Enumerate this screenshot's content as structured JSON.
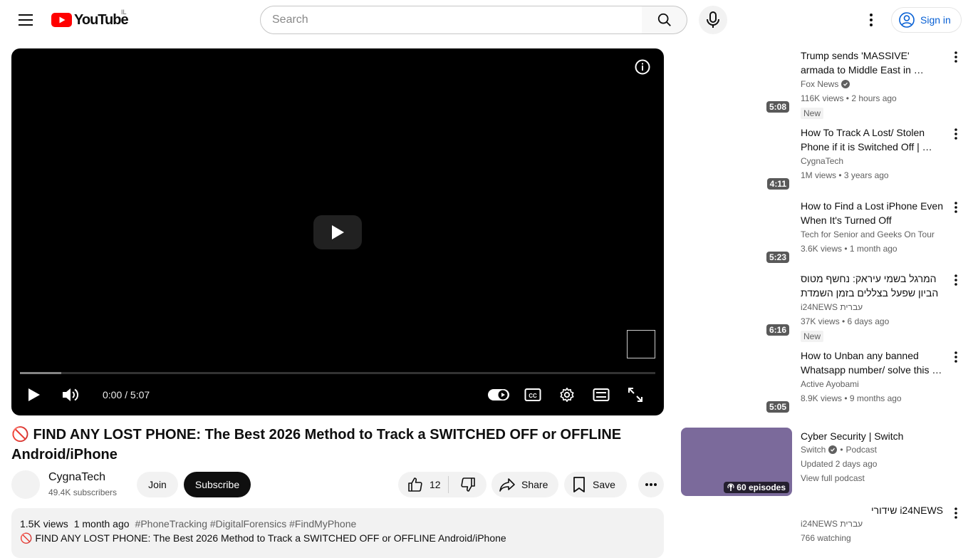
{
  "header": {
    "logo_text": "YouTube",
    "region": "IL",
    "search_placeholder": "Search",
    "signin_label": "Sign in"
  },
  "player": {
    "time_current": "0:00",
    "time_total": "5:07",
    "time_display": "0:00 / 5:07",
    "buffered_fraction": 0.065
  },
  "video": {
    "title": "🚫 FIND ANY LOST PHONE: The Best 2026 Method to Track a SWITCHED OFF or OFFLINE Android/iPhone",
    "channel_name": "CygnaTech",
    "subscribers": "49.4K subscribers",
    "join_label": "Join",
    "subscribe_label": "Subscribe",
    "like_count": "12",
    "share_label": "Share",
    "save_label": "Save",
    "views": "1.5K views",
    "age": "1 month ago",
    "tags": "#PhoneTracking #DigitalForensics #FindMyPhone",
    "description_first_line": "🚫 FIND ANY LOST PHONE: The Best 2026 Method to Track a SWITCHED OFF or OFFLINE Android/iPhone"
  },
  "recommendations": [
    {
      "title": "Trump sends 'MASSIVE' armada to Middle East in …",
      "channel": "Fox News",
      "verified": true,
      "meta": "116K views • 2 hours ago",
      "badge": "New",
      "duration": "5:08"
    },
    {
      "title": "How To Track A Lost/ Stolen Phone if it is Switched Off | …",
      "channel": "CygnaTech",
      "verified": false,
      "meta": "1M views • 3 years ago",
      "badge": "",
      "duration": "4:11"
    },
    {
      "title": "How to Find a Lost iPhone Even When It's Turned Off",
      "channel": "Tech for Senior and Geeks On Tour",
      "verified": false,
      "meta": "3.6K views • 1 month ago",
      "badge": "",
      "duration": "5:23"
    },
    {
      "title": "המרגל בשמי עיראק: נחשף מטוס הביון שפעל בצללים בזמן השמדת …",
      "channel": "i24NEWS עברית",
      "verified": false,
      "meta": "37K views • 6 days ago",
      "badge": "New",
      "duration": "6:16"
    },
    {
      "title": "How to Unban any banned Whatsapp number/ solve this …",
      "channel": "Active Ayobami",
      "verified": false,
      "meta": "8.9K views • 9 months ago",
      "badge": "",
      "duration": "5:05"
    }
  ],
  "podcast": {
    "title": "Cyber Security | Switch",
    "channel": "Switch",
    "type": "Podcast",
    "updated": "Updated 2 days ago",
    "link": "View full podcast",
    "episodes": "60 episodes"
  },
  "live": {
    "title": "i24NEWS שידורי",
    "channel": "i24NEWS עברית",
    "watching": "766 watching"
  }
}
